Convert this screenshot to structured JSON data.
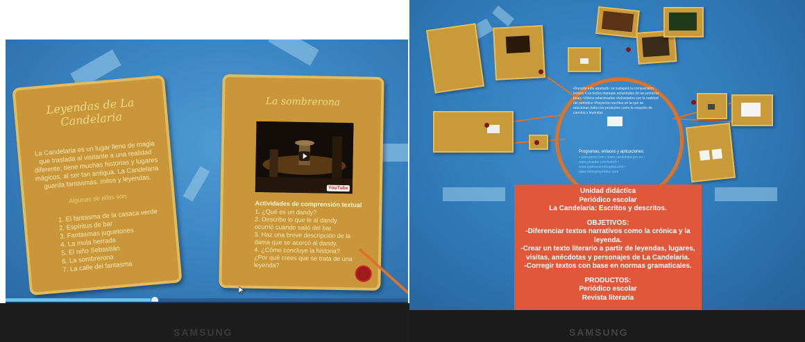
{
  "left": {
    "card1": {
      "title": "Leyendas de La Candelaria",
      "intro": "La Candelaria es un lugar lleno de magia que traslada al visitante a una realidad diferente; tiene muchas historias y lugares mágicos, al ser tan antigua. La Candelaria guarda fantasmas, mitos y leyendas.",
      "subhead": "Algunas de ellas son:",
      "items": [
        "1. El fantasma de la casaca verde",
        "2. Espíritus de bar",
        "3. Fantasmas juguetones",
        "4. La mula herrada",
        "5. El niño Sebastián",
        "6. La sombrerona",
        "7. La calle del fantasma"
      ]
    },
    "card2": {
      "title": "La sombrerona",
      "video_logo": "YouTube",
      "activities_title": "Actividades de comprensión textual",
      "activities": [
        "1. ¿Qué es un dandy?",
        "2. Describe lo que le al dandy ocurrió cuando salió del bar.",
        "3. Haz una breve descripción de la dama que se acercó al dandy.",
        "4. ¿Cómo concluye la historia? ¿Por qué crees que se trata de una leyenda?"
      ]
    },
    "nav": {
      "prev": "←",
      "next": "→"
    },
    "progress": 0.37,
    "brand": "SAMSUNG"
  },
  "right": {
    "ring_text": "•Durante este apartado: se trabajará la comprensión lectora •Los textos manejan actividades de las primeras fases •Videos relacionados •Actividades con la realidad del periódico •Proyectos escritos en la que se relacionan todos los productos como la creación de cuentos y leyendas",
    "ring_head": "Programas, enlaces y aplicaciones:",
    "ring_links": "• www.prezi.com • www.candelaria.gov.co • www.youtube.com/watch • www.quehacerenbogota.com • www.mitosyleyendas.com",
    "objectives_lines": [
      "Unidad didáctica",
      "Periódico escolar",
      "La Candelaria: Escritos y descritos.",
      "",
      "OBJETIVOS:",
      "-Diferenciar textos narrativos como la crónica y la leyenda.",
      "-Crear un texto literario a partir de leyendas, lugares, visitas, anécdotas y personajes de La Candelaria.",
      "-Corregir textos con base en normas gramaticales.",
      "",
      "PRODUCTOS:",
      "Periódico escolar",
      "Revista literaria"
    ],
    "brand": "SAMSUNG"
  },
  "colors": {
    "screen_blue": "#3b86c4",
    "card_gold": "#c9973a",
    "accent_orange": "#d9732d",
    "panel_red": "#e0573a"
  }
}
